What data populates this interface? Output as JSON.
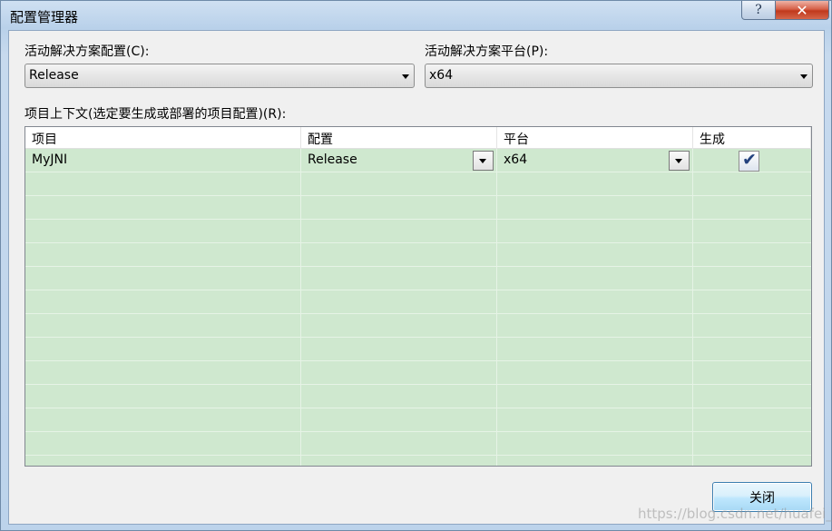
{
  "window": {
    "title": "配置管理器",
    "help_glyph": "?",
    "close_glyph": "✕"
  },
  "active_config": {
    "label": "活动解决方案配置(C):",
    "value": "Release"
  },
  "active_platform": {
    "label": "活动解决方案平台(P):",
    "value": "x64"
  },
  "project_context": {
    "label": "项目上下文(选定要生成或部署的项目配置)(R):",
    "headers": [
      "项目",
      "配置",
      "平台",
      "生成"
    ],
    "rows": [
      {
        "project": "MyJNI",
        "configuration": "Release",
        "platform": "x64",
        "build": true
      }
    ]
  },
  "buttons": {
    "close_label": "关闭"
  },
  "check_glyph": "✔",
  "watermark": "https://blog.csdn.net/huafei_c",
  "colors": {
    "grid_row_bg": "#cfe8cf",
    "close_button_red": "#c0391c"
  }
}
